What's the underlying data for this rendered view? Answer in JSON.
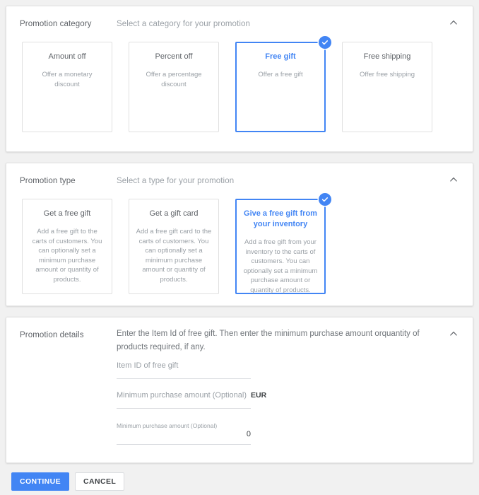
{
  "sections": {
    "category": {
      "label": "Promotion category",
      "subtitle": "Select a category for your promotion",
      "collapse_icon": "chevron-up-icon",
      "options": [
        {
          "title": "Amount off",
          "desc": "Offer a monetary discount",
          "selected": false
        },
        {
          "title": "Percent off",
          "desc": "Offer a percentage discount",
          "selected": false
        },
        {
          "title": "Free gift",
          "desc": "Offer a free gift",
          "selected": true
        },
        {
          "title": "Free shipping",
          "desc": "Offer free shipping",
          "selected": false
        }
      ]
    },
    "type": {
      "label": "Promotion type",
      "subtitle": "Select a type for your promotion",
      "collapse_icon": "chevron-up-icon",
      "options": [
        {
          "title": "Get a free gift",
          "desc": "Add a free gift to the carts of customers. You can optionally set a minimum purchase amount or quantity of products.",
          "selected": false
        },
        {
          "title": "Get a gift card",
          "desc": "Add a free gift card to the carts of customers. You can optionally set a minimum purchase amount or quantity of products.",
          "selected": false
        },
        {
          "title": "Give a free gift from your inventory",
          "desc": "Add a free gift from your inventory to the carts of customers. You can optionally set a minimum purchase amount or quantity of products.",
          "selected": true
        }
      ]
    },
    "details": {
      "label": "Promotion details",
      "intro": "Enter the Item Id of free gift. Then enter the minimum purchase amount orquantity of products required, if any.",
      "collapse_icon": "chevron-up-icon",
      "fields": {
        "item_id": {
          "placeholder": "Item ID of free gift",
          "value": ""
        },
        "min_amount": {
          "placeholder": "Minimum purchase amount (Optional)",
          "suffix": "EUR",
          "value": ""
        },
        "min_quantity": {
          "floating_label": "Minimum purchase amount (Optional)",
          "value": "0"
        }
      }
    }
  },
  "footer": {
    "continue_label": "CONTINUE",
    "cancel_label": "CANCEL"
  },
  "colors": {
    "accent": "#4285f4",
    "text_primary": "#3c4043",
    "text_secondary": "#5f6368",
    "text_muted": "#9aa0a6",
    "page_background": "#f1f1f1",
    "panel_background": "#ffffff"
  }
}
